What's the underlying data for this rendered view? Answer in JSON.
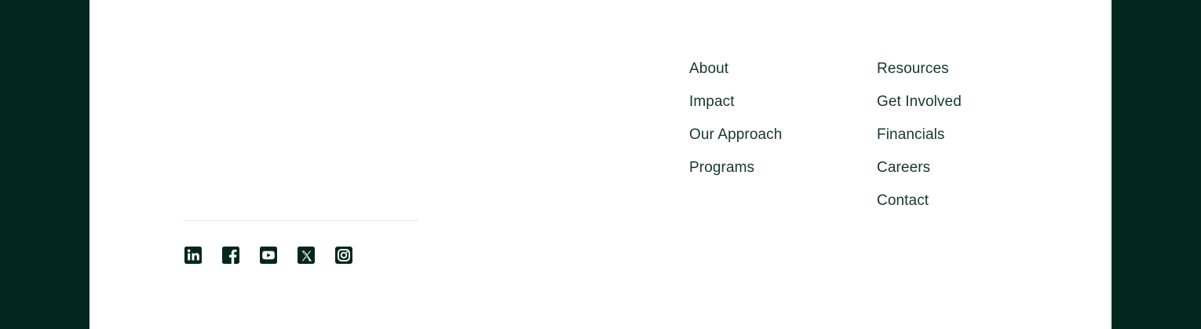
{
  "footer": {
    "nav_col_1": [
      "About",
      "Impact",
      "Our Approach",
      "Programs"
    ],
    "nav_col_2": [
      "Resources",
      "Get Involved",
      "Financials",
      "Careers",
      "Contact"
    ],
    "social": [
      {
        "icon": "linkedin-icon"
      },
      {
        "icon": "facebook-icon"
      },
      {
        "icon": "youtube-icon"
      },
      {
        "icon": "x-twitter-icon"
      },
      {
        "icon": "instagram-icon"
      }
    ]
  },
  "colors": {
    "outer_background": "#03271f",
    "panel_background": "#ffffff",
    "text": "#15382f",
    "icon": "#03271f",
    "divider": "#e5e9e7"
  }
}
